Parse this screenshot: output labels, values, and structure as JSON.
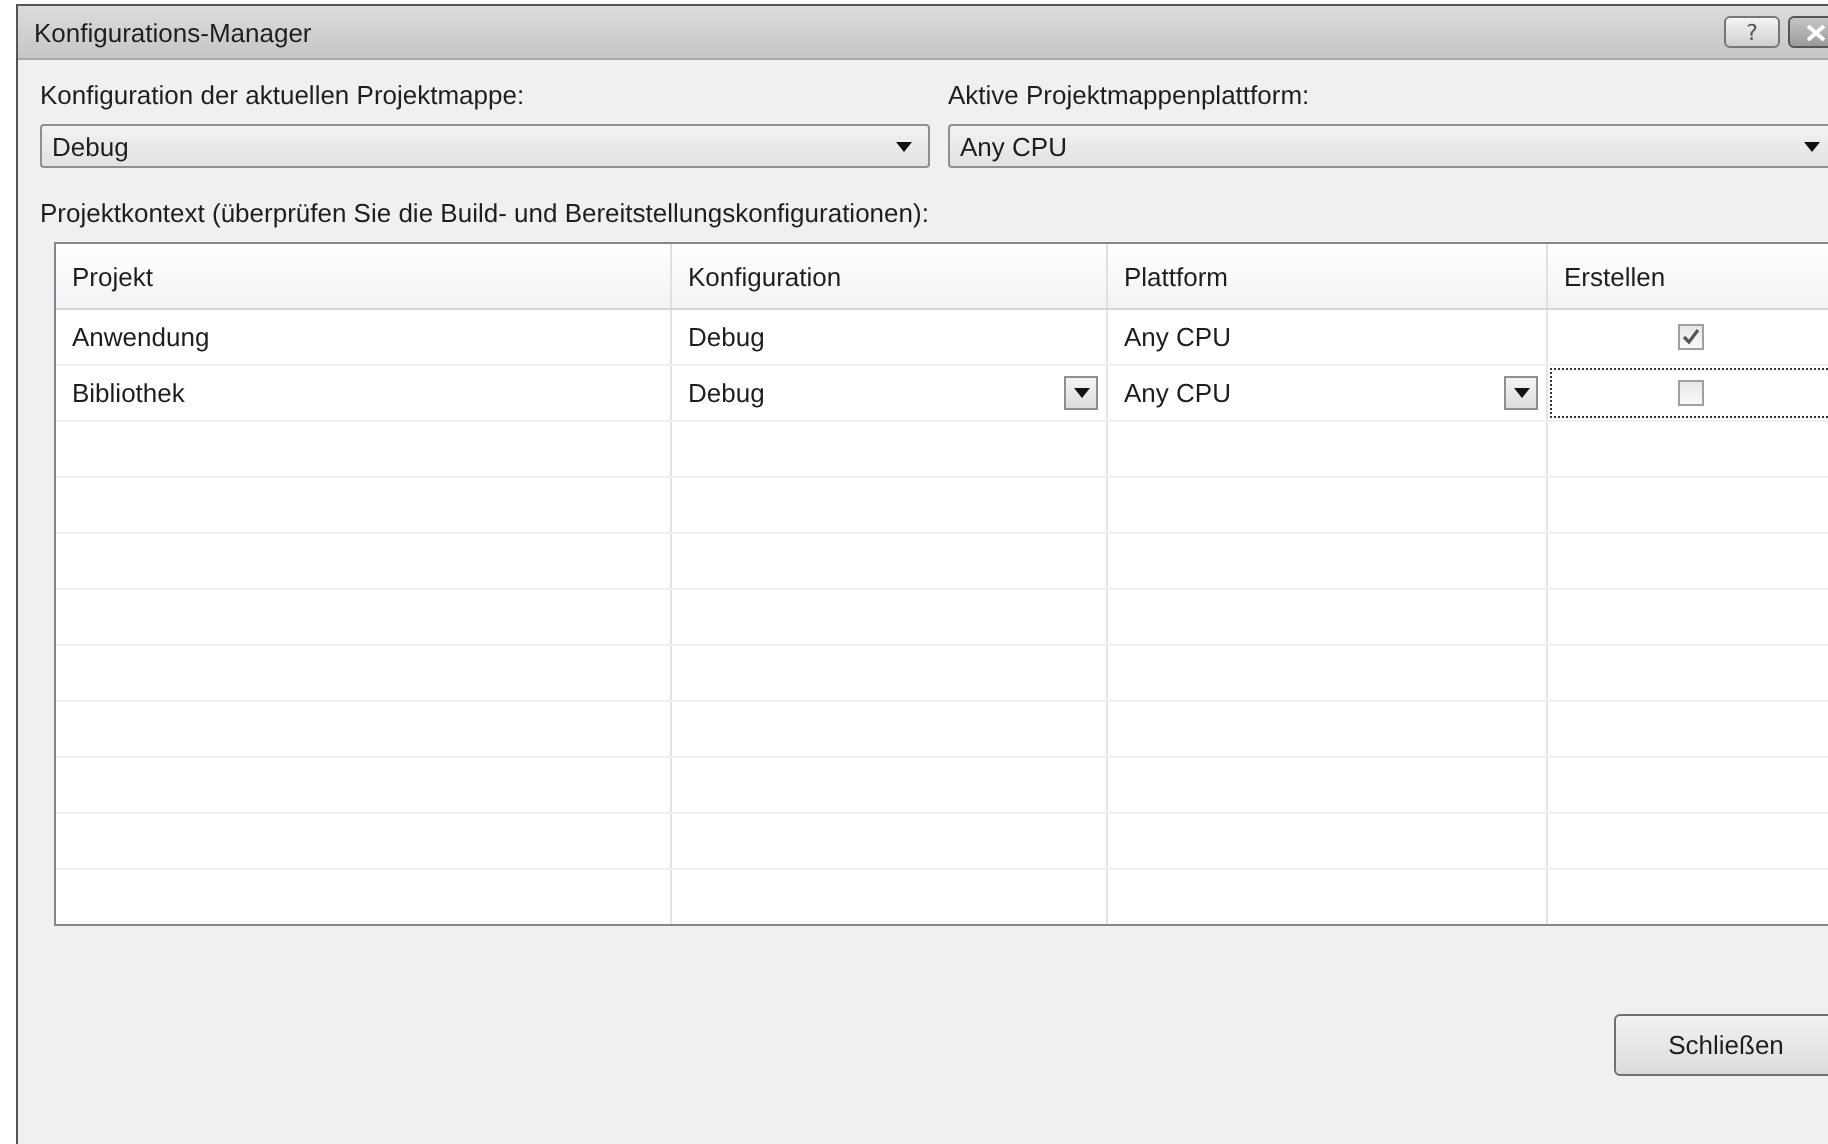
{
  "window": {
    "title": "Konfigurations-Manager",
    "help_button": "?"
  },
  "solution_configuration": {
    "label": "Konfiguration der aktuellen Projektmappe:",
    "value": "Debug"
  },
  "solution_platform": {
    "label": "Aktive Projektmappenplattform:",
    "value": "Any CPU"
  },
  "project_context": {
    "label": "Projektkontext (überprüfen Sie die Build- und Bereitstellungskonfigurationen):"
  },
  "table": {
    "columns": [
      "Projekt",
      "Konfiguration",
      "Plattform",
      "Erstellen"
    ],
    "rows": [
      {
        "project": "Anwendung",
        "configuration": "Debug",
        "platform": "Any CPU",
        "build": {
          "checked": true
        },
        "selected": false
      },
      {
        "project": "Bibliothek",
        "configuration": "Debug",
        "platform": "Any CPU",
        "build": {
          "checked": false
        },
        "selected": true
      }
    ]
  },
  "buttons": [
    "Schließen"
  ]
}
